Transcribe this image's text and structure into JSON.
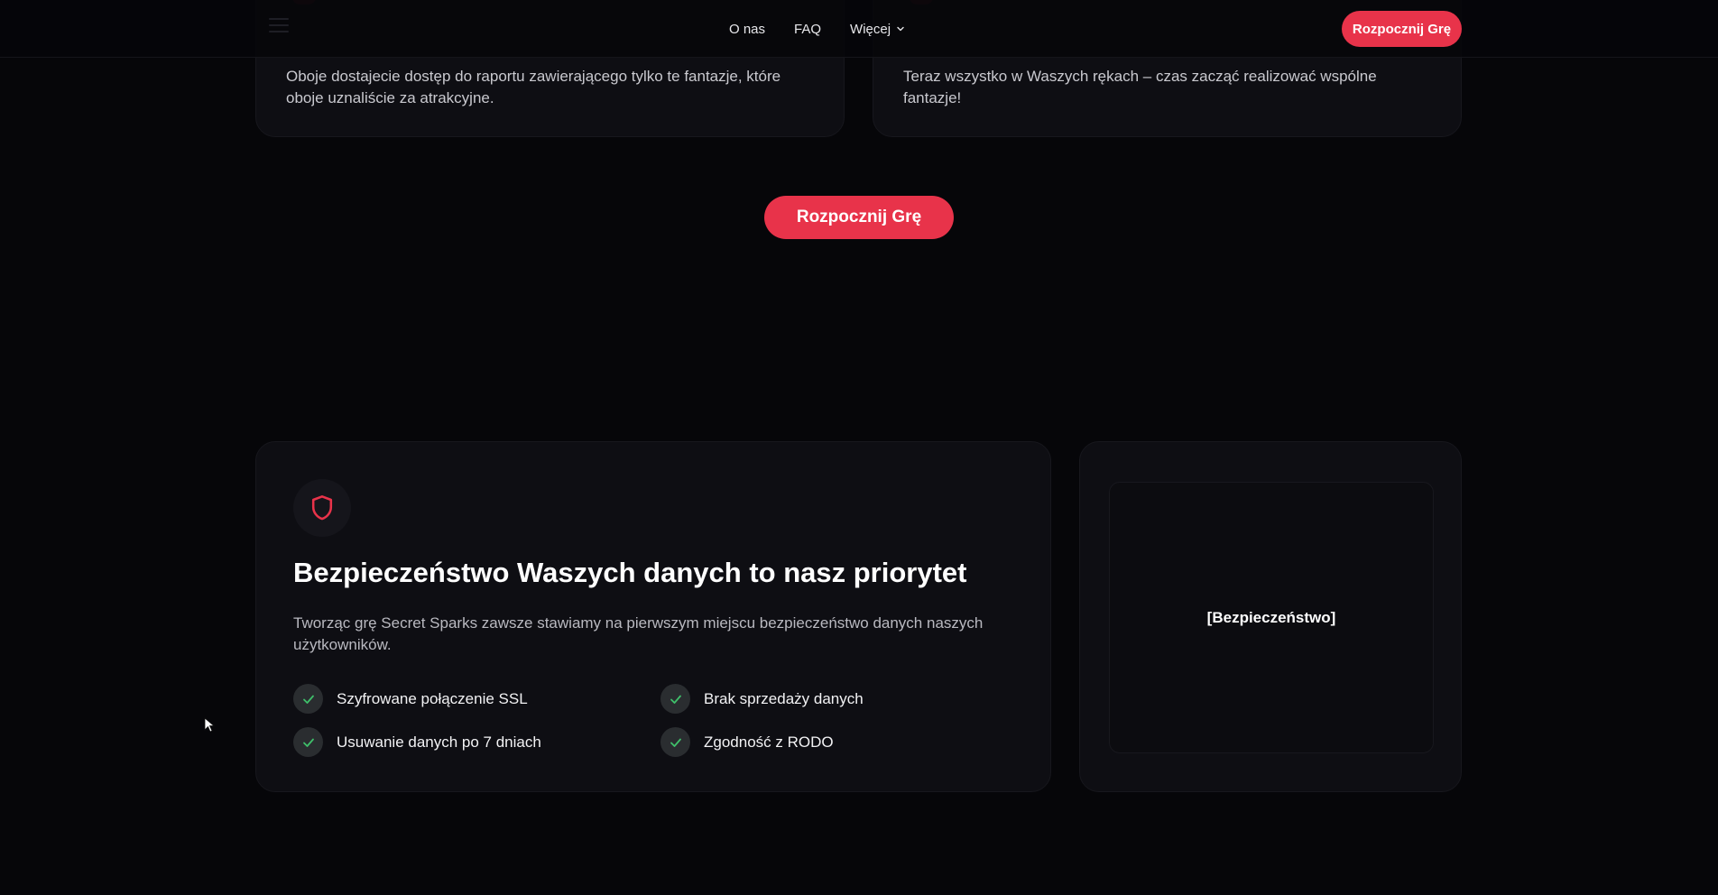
{
  "header": {
    "nav": [
      {
        "label": "O nas"
      },
      {
        "label": "FAQ"
      },
      {
        "label": "Więcej"
      }
    ],
    "cta_label": "Rozpocznij Grę"
  },
  "steps": [
    {
      "text": "Oboje dostajecie dostęp do raportu zawierającego tylko te fantazje, które oboje uznaliście za atrakcyjne."
    },
    {
      "text": "Teraz wszystko w Waszych rękach – czas zacząć realizować wspólne fantazje!"
    }
  ],
  "cta": {
    "label": "Rozpocznij Grę"
  },
  "security": {
    "title": "Bezpieczeństwo Waszych danych to nasz priorytet",
    "description": "Tworząc grę Secret Sparks zawsze stawiamy na pierwszym miejscu bezpieczeństwo danych naszych użytkowników.",
    "features": [
      "Szyfrowane połączenie SSL",
      "Brak sprzedaży danych",
      "Usuwanie danych po 7 dniach",
      "Zgodność z RODO"
    ],
    "image_placeholder": "[Bezpieczeństwo]",
    "icon": "shield-icon"
  },
  "colors": {
    "background": "#060609",
    "card": "#0e0e13",
    "accent": "#e8334a",
    "check": "#3fbf6a"
  }
}
